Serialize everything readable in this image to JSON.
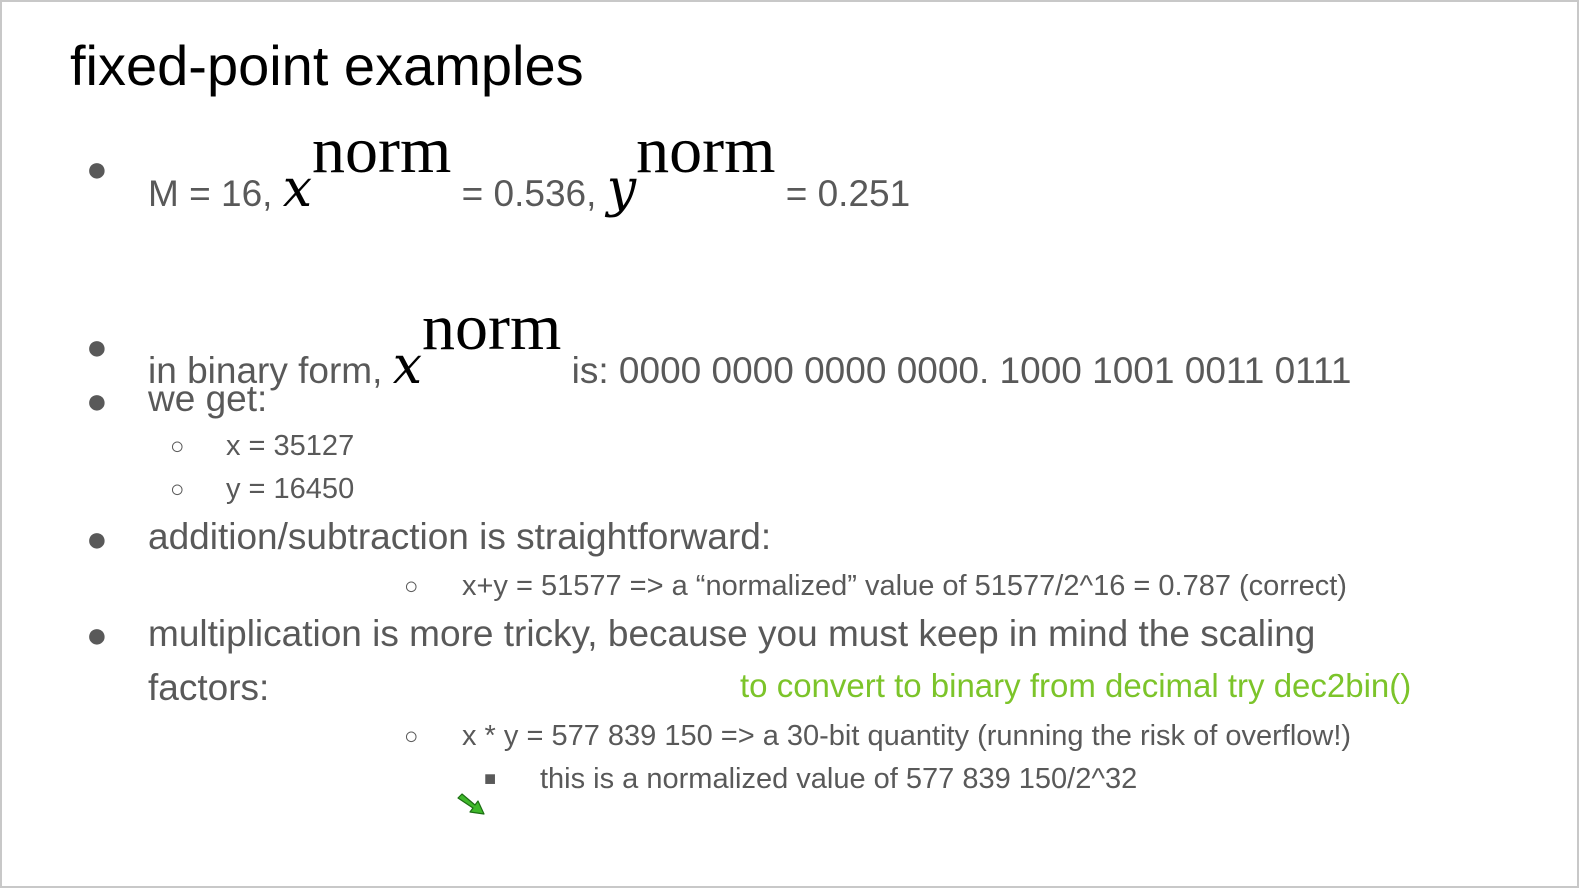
{
  "title": "fixed-point examples",
  "colors": {
    "text": "#595959",
    "title": "#000000",
    "note": "#7cc42a",
    "arrow": "#3fb82b"
  },
  "lines": {
    "l1": {
      "part1": "M = 16,",
      "var1": "x",
      "sup1": "norm",
      "part2": "= 0.536,",
      "var2": "y",
      "sup2": "norm",
      "part3": "= 0.251"
    },
    "l2": {
      "part1": "in binary form,",
      "var": "x",
      "sup": "norm",
      "part2": "is: 0000 0000 0000 0000. 1000 1001 0011 0111"
    },
    "l3": {
      "text": "we get:"
    },
    "l3a": {
      "text": "x = 35127"
    },
    "l3b": {
      "text": "y = 16450"
    },
    "l4": {
      "text": "addition/subtraction is straightforward:"
    },
    "l4a": {
      "text": "x+y = 51577 => a “normalized” value of 51577/2^16 = 0.787 (correct)"
    },
    "l5": {
      "text1": "multiplication is more tricky, because you must keep in mind the scaling",
      "text2": "factors:"
    },
    "note": {
      "text": "to convert to binary from decimal try dec2bin()"
    },
    "l5a": {
      "text": "x * y = 577 839 150 => a 30-bit quantity (running the risk of overflow!)"
    },
    "l5b": {
      "text": "this is a normalized value of 577 839 150/2^32"
    }
  },
  "icons": {
    "bullet": "filled-circle",
    "sub_bullet": "hollow-circle",
    "sub_sub_bullet": "filled-square",
    "pointer": "green-arrow-icon"
  }
}
